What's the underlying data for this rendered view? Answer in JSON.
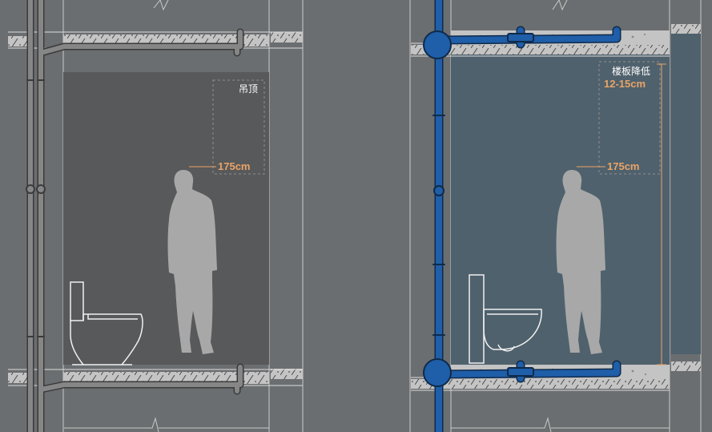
{
  "left_section": {
    "ceiling_label": "吊顶",
    "height_label": "175cm"
  },
  "right_section": {
    "floor_drop_label": "楼板降低",
    "floor_drop_value": "12-15cm",
    "height_label": "175cm"
  },
  "colors": {
    "background": "#6b6e70",
    "left_room": "#58595a",
    "right_room": "#4f616c",
    "blue_pipe": "#1f5ea8",
    "grey_pipe": "#858585",
    "slab": "#c4c4c4",
    "person": "#a8a8a8",
    "dimension": "#e9a468"
  }
}
